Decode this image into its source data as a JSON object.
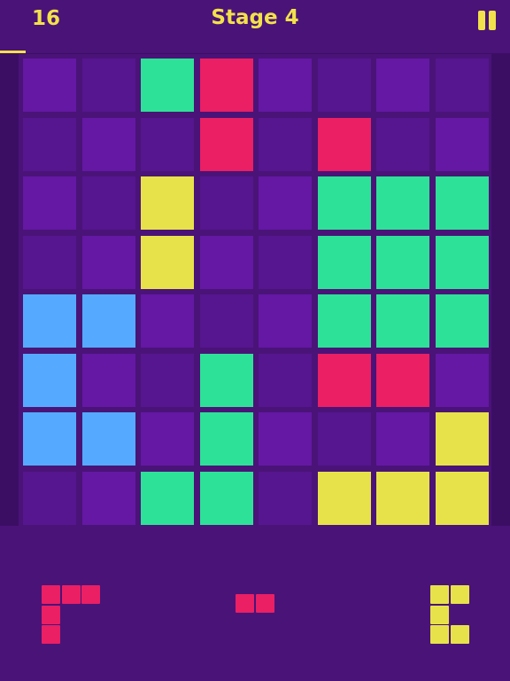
{
  "header": {
    "score": "16",
    "title": "Stage 4",
    "pause_icon": "pause-icon",
    "progress_fraction": 0.05
  },
  "colors": {
    "yellow": "#e8e24a",
    "green": "#2ee198",
    "red": "#ea1f64",
    "blue": "#55aaff",
    "empty_a": "#6418a4",
    "empty_b": "#56168f",
    "text": "#f2e14a"
  },
  "board": {
    "rows": 8,
    "cols": 8,
    "cells": [
      [
        "a",
        "b",
        "G",
        "R",
        "a",
        "b",
        "a",
        "b"
      ],
      [
        "b",
        "a",
        "b",
        "R",
        "b",
        "R",
        "b",
        "a"
      ],
      [
        "a",
        "b",
        "Y",
        "b",
        "a",
        "G",
        "G",
        "G"
      ],
      [
        "b",
        "a",
        "Y",
        "a",
        "b",
        "G",
        "G",
        "G"
      ],
      [
        "B",
        "B",
        "a",
        "b",
        "a",
        "G",
        "G",
        "G"
      ],
      [
        "B",
        "a",
        "b",
        "G",
        "b",
        "R",
        "R",
        "a"
      ],
      [
        "B",
        "B",
        "a",
        "G",
        "a",
        "b",
        "a",
        "Y"
      ],
      [
        "b",
        "a",
        "G",
        "G",
        "b",
        "Y",
        "Y",
        "Y"
      ]
    ]
  },
  "tray": {
    "pieces": [
      {
        "name": "corner-piece-red",
        "color": "R",
        "blocks": [
          [
            0,
            0
          ],
          [
            0,
            1
          ],
          [
            0,
            2
          ],
          [
            1,
            0
          ],
          [
            2,
            0
          ]
        ]
      },
      {
        "name": "domino-piece-red",
        "color": "R",
        "blocks": [
          [
            0,
            0
          ],
          [
            0,
            1
          ]
        ]
      },
      {
        "name": "bracket-piece-yellow",
        "color": "Y",
        "blocks": [
          [
            0,
            0
          ],
          [
            0,
            1
          ],
          [
            1,
            0
          ],
          [
            2,
            0
          ],
          [
            2,
            1
          ]
        ]
      }
    ]
  }
}
